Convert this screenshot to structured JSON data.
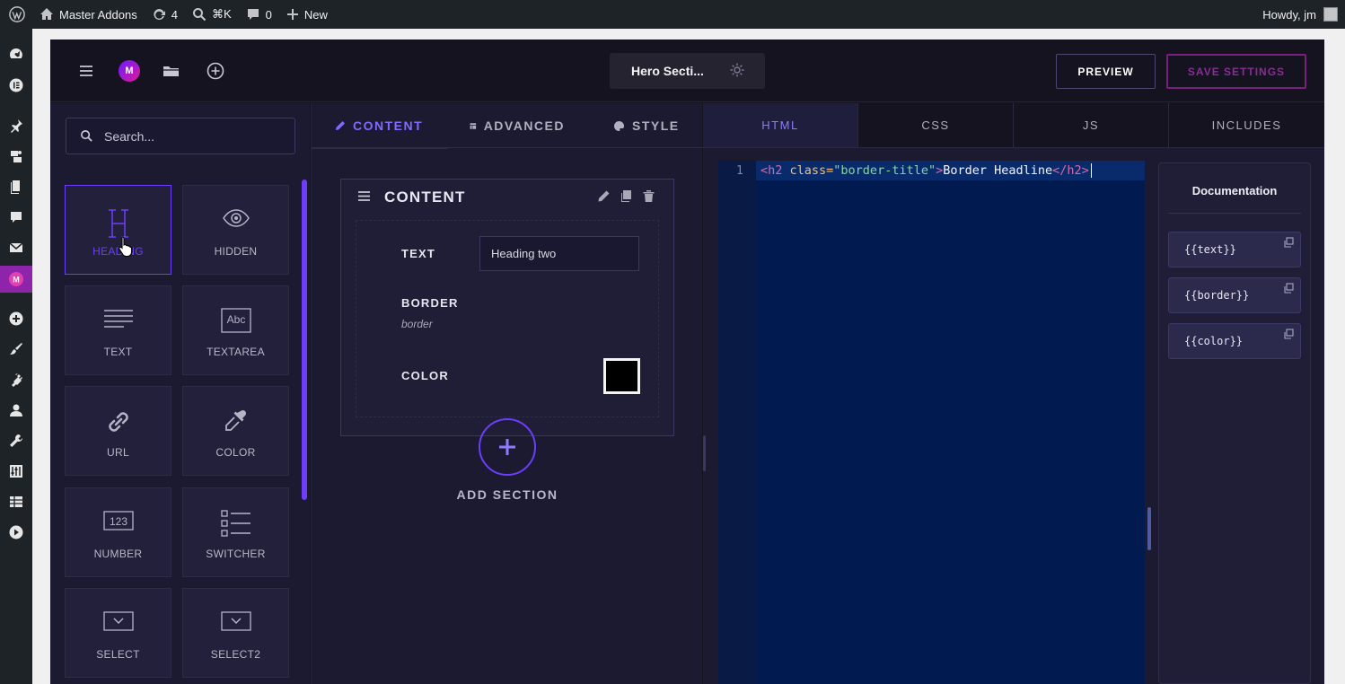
{
  "adminbar": {
    "site_name": "Master Addons",
    "updates_count": "4",
    "search_shortcut": "⌘K",
    "comments_count": "0",
    "new_label": "New",
    "greeting": "Howdy, jm"
  },
  "topbar": {
    "page_title": "Hero Secti...",
    "preview_label": "PREVIEW",
    "save_label": "SAVE SETTINGS"
  },
  "widgets": {
    "search_placeholder": "Search...",
    "items": [
      {
        "label": "HEADING"
      },
      {
        "label": "HIDDEN"
      },
      {
        "label": "TEXT"
      },
      {
        "label": "TEXTAREA"
      },
      {
        "label": "URL"
      },
      {
        "label": "COLOR"
      },
      {
        "label": "NUMBER"
      },
      {
        "label": "SWITCHER"
      },
      {
        "label": "SELECT"
      },
      {
        "label": "SELECT2"
      }
    ],
    "active_index": 0
  },
  "editor_tabs": [
    {
      "label": "CONTENT",
      "active": true
    },
    {
      "label": "ADVANCED",
      "active": false
    },
    {
      "label": "STYLE",
      "active": false
    }
  ],
  "section": {
    "title": "CONTENT",
    "fields": {
      "text_label": "TEXT",
      "text_value": "Heading two",
      "border_label": "BORDER",
      "border_sub": "border",
      "color_label": "COLOR",
      "color_value": "#000000"
    }
  },
  "add_section_label": "ADD SECTION",
  "code_tabs": [
    {
      "label": "HTML",
      "active": true
    },
    {
      "label": "CSS",
      "active": false
    },
    {
      "label": "JS",
      "active": false
    },
    {
      "label": "INCLUDES",
      "active": false
    }
  ],
  "code": {
    "line_number": "1",
    "tag_open": "<h2",
    "attr_name": " class=",
    "attr_value": "\"border-title\"",
    "tag_close_bracket": ">",
    "inner_text": "Border Headline",
    "tag_end": "</h2>"
  },
  "documentation": {
    "title": "Documentation",
    "items": [
      "{{text}}",
      "{{border}}",
      "{{color}}"
    ]
  },
  "colors": {
    "accent": "#6d3dfa",
    "save_border": "#7a1f7c",
    "admin_bg": "#1d2327",
    "panel_bg": "#1c1a30",
    "editor_bg": "#011a4f"
  }
}
